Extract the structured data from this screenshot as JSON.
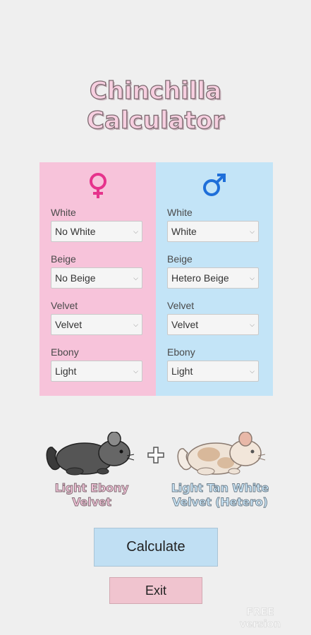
{
  "app": {
    "title_line1": "Chinchilla",
    "title_line2": "Calculator"
  },
  "female": {
    "icon": "female-symbol",
    "color": "#e6338c",
    "fields": [
      {
        "label": "White",
        "value": "No White"
      },
      {
        "label": "Beige",
        "value": "No Beige"
      },
      {
        "label": "Velvet",
        "value": "Velvet"
      },
      {
        "label": "Ebony",
        "value": "Light"
      }
    ],
    "result": "Light Ebony Velvet"
  },
  "male": {
    "icon": "male-symbol",
    "color": "#1f6fd9",
    "fields": [
      {
        "label": "White",
        "value": "White"
      },
      {
        "label": "Beige",
        "value": "Hetero Beige"
      },
      {
        "label": "Velvet",
        "value": "Velvet"
      },
      {
        "label": "Ebony",
        "value": "Light"
      }
    ],
    "result": "Light Tan White Velvet (Hetero)"
  },
  "buttons": {
    "calculate": "Calculate",
    "exit": "Exit"
  },
  "badge": "FREE version"
}
